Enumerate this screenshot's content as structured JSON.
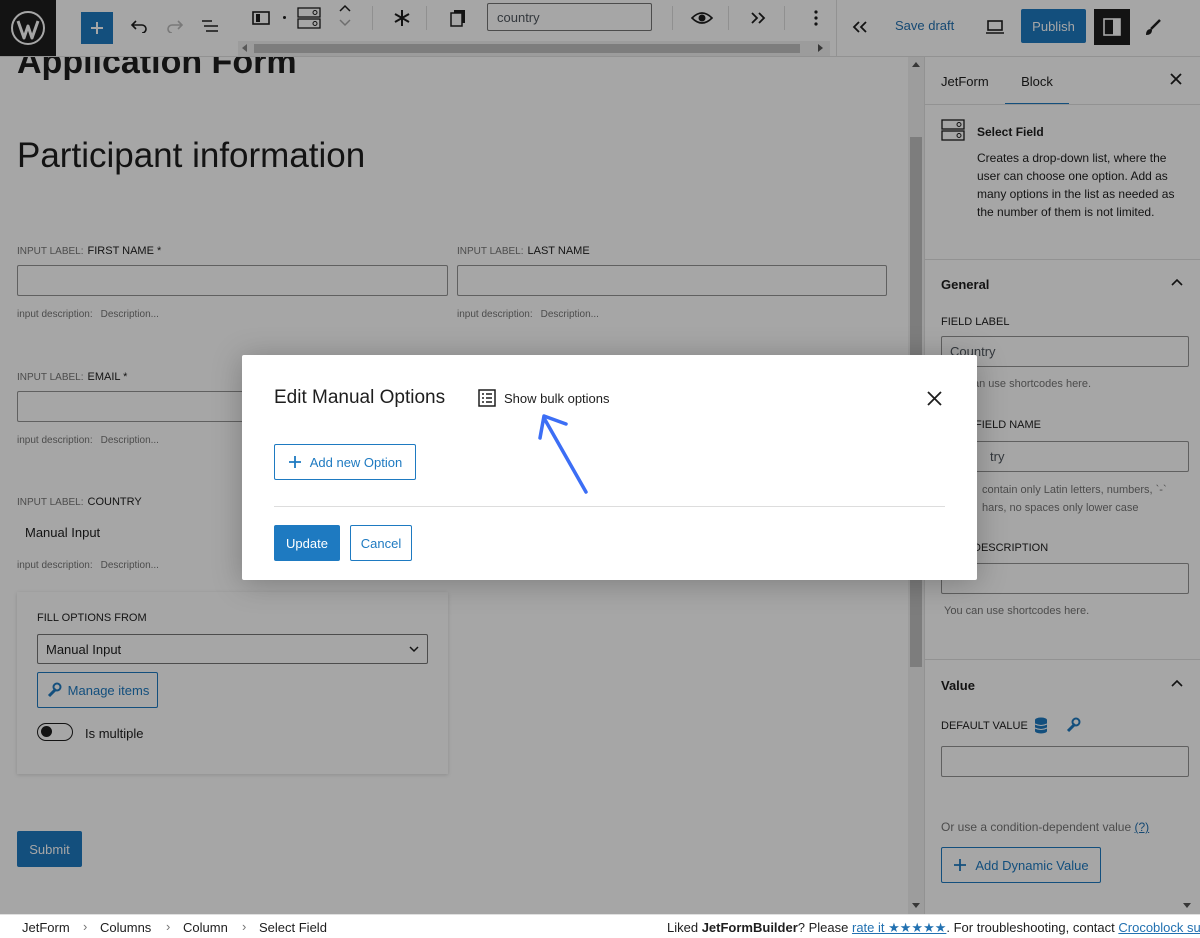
{
  "toolbar": {
    "search_value": "country",
    "save_draft": "Save draft",
    "publish": "Publish"
  },
  "canvas": {
    "form_title": "Application Form",
    "section_heading": "Participant information",
    "input_label_prefix": "INPUT LABEL:",
    "input_desc_prefix": "input description:",
    "input_desc_placeholder": "Description...",
    "fields": [
      {
        "label": "FIRST NAME *"
      },
      {
        "label": "LAST NAME"
      },
      {
        "label": "EMAIL *"
      },
      {
        "label": "COUNTRY",
        "value": "Manual Input"
      }
    ],
    "fill_options_label": "FILL OPTIONS FROM",
    "fill_options_value": "Manual Input",
    "manage_items": "Manage items",
    "is_multiple": "Is multiple",
    "is_multiple_checked": false,
    "submit": "Submit"
  },
  "sidebar": {
    "tabs": [
      "JetForm",
      "Block"
    ],
    "active_tab": "Block",
    "block_title": "Select Field",
    "block_desc": "Creates a drop-down list, where the user can choose one option. Add as many options in the list as needed as the number of them is not limited.",
    "general_title": "General",
    "field_label_lbl": "FIELD LABEL",
    "field_label_value": "Country",
    "field_label_help": "an use shortcodes here.",
    "field_name_lbl": "FIELD NAME",
    "field_name_value": "try",
    "field_name_help_1": "contain only Latin letters, numbers, `-`",
    "field_name_help_2": "hars, no spaces only lower case",
    "desc_lbl": "DESCRIPTION",
    "desc_help": "You can use shortcodes here.",
    "value_title": "Value",
    "default_value_lbl": "DEFAULT VALUE",
    "condition_text": "Or use a condition-dependent value",
    "condition_link": "(?)",
    "add_dynamic": "Add Dynamic Value"
  },
  "breadcrumb": {
    "items": [
      "JetForm",
      "Columns",
      "Column",
      "Select Field"
    ],
    "footer_text_1": "Liked ",
    "footer_brand": "JetFormBuilder",
    "footer_text_2": "? Please ",
    "footer_rate": "rate it ★★★★★",
    "footer_text_3": ". For troubleshooting, contact ",
    "footer_link": "Crocoblock supp"
  },
  "modal": {
    "title": "Edit Manual Options",
    "bulk_label": "Show bulk options",
    "add_option": "Add new Option",
    "update": "Update",
    "cancel": "Cancel"
  },
  "colors": {
    "accent": "#1e7ac1",
    "annotation_arrow": "#3c6ef5",
    "overlay": "rgba(0,0,0,0.35)"
  }
}
